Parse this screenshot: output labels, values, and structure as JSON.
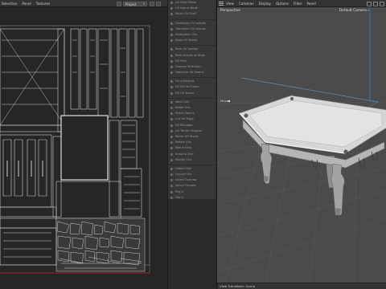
{
  "uv_editor": {
    "menu": [
      "Selection",
      "Panel",
      "Textures"
    ],
    "project_dropdown": "Project"
  },
  "uv_tools": {
    "groups": [
      [
        "UV Shell Mode",
        "UV Island Mode",
        "Relax UV Shell"
      ],
      [
        "Distribute UV Islands",
        "Transform UV Islands",
        "Straighten UVs",
        "Align UV Points"
      ],
      [
        "Pack UV Islands",
        "Pack Islands to Atlas",
        "UV Peel",
        "Unwrap Selection",
        "Optimize UV Seams"
      ],
      [
        "Fit to Bounds",
        "Fit UVs to Frame",
        "Fill UV Space"
      ],
      [
        "Weld UVs",
        "Break UVs",
        "Stitch Seams",
        "Cut UV Edge",
        "UV Manager",
        "UV Terrain Mapper",
        "Mirror UV Shells",
        "Rotate UVs",
        "Match Grid",
        "Snap to Grid",
        "Rectify UVs"
      ],
      [
        "Unfold UVs",
        "Layout UVs",
        "Select Overlap",
        "Select Flipped",
        "Flip U",
        "Flip V",
        "Normalize UVs"
      ]
    ]
  },
  "viewport": {
    "menu": [
      "View",
      "Cameras",
      "Display",
      "Options",
      "Filter",
      "Panel"
    ],
    "label": "Perspective",
    "camera": "Default Camera",
    "move_label": "Move",
    "status": "View Transform: Scene"
  }
}
